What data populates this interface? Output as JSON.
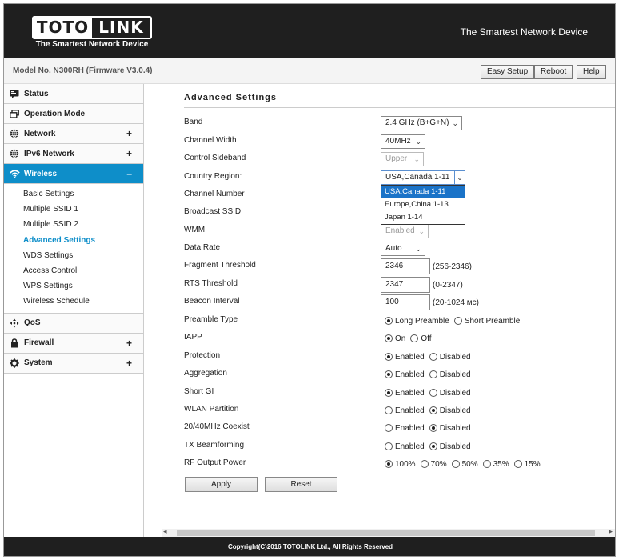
{
  "header": {
    "logo_left": "TOTO",
    "logo_right": "LINK",
    "logo_tagline": "The Smartest Network Device",
    "tagline": "The Smartest Network Device"
  },
  "topbar": {
    "model": "Model No. N300RH (Firmware V3.0.4)",
    "easy_setup": "Easy Setup",
    "reboot": "Reboot",
    "help": "Help"
  },
  "sidebar": {
    "status": "Status",
    "operation_mode": "Operation Mode",
    "network": "Network",
    "ipv6_network": "IPv6 Network",
    "wireless": "Wireless",
    "wireless_sub": [
      "Basic Settings",
      "Multiple SSID 1",
      "Multiple SSID 2",
      "Advanced Settings",
      "WDS Settings",
      "Access Control",
      "WPS Settings",
      "Wireless Schedule"
    ],
    "qos": "QoS",
    "firewall": "Firewall",
    "system": "System",
    "plus": "+",
    "minus": "–"
  },
  "page": {
    "title": "Advanced Settings",
    "labels": {
      "band": "Band",
      "channel_width": "Channel Width",
      "control_sideband": "Control Sideband",
      "country_region": "Country Region:",
      "channel_number": "Channel Number",
      "broadcast_ssid": "Broadcast SSID",
      "wmm": "WMM",
      "data_rate": "Data Rate",
      "fragment_threshold": "Fragment Threshold",
      "rts_threshold": "RTS Threshold",
      "beacon_interval": "Beacon Interval",
      "preamble_type": "Preamble Type",
      "iapp": "IAPP",
      "protection": "Protection",
      "aggregation": "Aggregation",
      "short_gi": "Short GI",
      "wlan_partition": "WLAN Partition",
      "coexist": "20/40MHz Coexist",
      "tx_beamforming": "TX Beamforming",
      "rf_output_power": "RF Output Power"
    },
    "values": {
      "band": "2.4 GHz (B+G+N)",
      "channel_width": "40MHz",
      "control_sideband": "Upper",
      "country_region": "USA,Canada 1-11",
      "wmm": "Enabled",
      "data_rate": "Auto",
      "fragment_threshold": "2346",
      "fragment_hint": "(256-2346)",
      "rts_threshold": "2347",
      "rts_hint": "(0-2347)",
      "beacon_interval": "100",
      "beacon_hint": "(20-1024 мс)"
    },
    "country_options": [
      "USA,Canada 1-11",
      "Europe,China 1-13",
      "Japan 1-14"
    ],
    "radio_text": {
      "long_preamble": "Long Preamble",
      "short_preamble": "Short Preamble",
      "on": "On",
      "off": "Off",
      "enabled": "Enabled",
      "disabled": "Disabled",
      "p100": "100%",
      "p70": "70%",
      "p50": "50%",
      "p35": "35%",
      "p15": "15%"
    },
    "apply": "Apply",
    "reset": "Reset"
  },
  "footer": {
    "copyright": "Copyright(C)2016 TOTOLINK Ltd., All Rights Reserved"
  }
}
